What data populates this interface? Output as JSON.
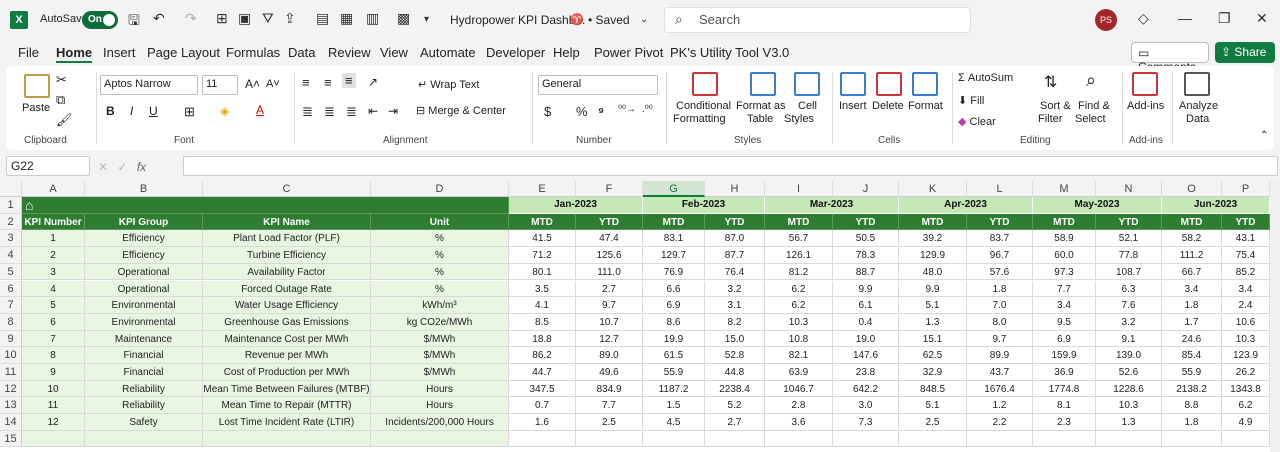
{
  "titlebar": {
    "app_icon": "X",
    "autosave_label": "AutoSave",
    "autosave_state": "On",
    "doc_title": "Hydropower KPI Dashb...",
    "saved_status": "• Saved",
    "search_placeholder": "Search",
    "avatar_initials": "PS"
  },
  "menu": [
    "File",
    "Home",
    "Insert",
    "Page Layout",
    "Formulas",
    "Data",
    "Review",
    "View",
    "Automate",
    "Developer",
    "Help",
    "Power Pivot",
    "PK's Utility Tool V3.0"
  ],
  "menu_active": "Home",
  "comments_label": "Comments",
  "share_label": "Share",
  "ribbon": {
    "paste": "Paste",
    "clipboard": "Clipboard",
    "font_name": "Aptos Narrow",
    "font_size": "11",
    "font_group": "Font",
    "wrap_text": "Wrap Text",
    "merge_center": "Merge & Center",
    "alignment_group": "Alignment",
    "number_format": "General",
    "number_group": "Number",
    "conditional_formatting_1": "Conditional",
    "conditional_formatting_2": "Formatting",
    "format_as_table_1": "Format as",
    "format_as_table_2": "Table",
    "cell_styles_1": "Cell",
    "cell_styles_2": "Styles",
    "styles_group": "Styles",
    "insert": "Insert",
    "delete": "Delete",
    "format": "Format",
    "cells_group": "Cells",
    "autosum": "AutoSum",
    "fill": "Fill",
    "clear": "Clear",
    "sort_filter_1": "Sort &",
    "sort_filter_2": "Filter",
    "find_select_1": "Find &",
    "find_select_2": "Select",
    "editing_group": "Editing",
    "addins": "Add-ins",
    "addins_group": "Add-ins",
    "analyze_data_1": "Analyze",
    "analyze_data_2": "Data"
  },
  "formula_bar": {
    "name_box": "G22",
    "fx": "fx"
  },
  "columns": [
    "A",
    "B",
    "C",
    "D",
    "E",
    "F",
    "G",
    "H",
    "I",
    "J",
    "K",
    "L",
    "M",
    "N",
    "O",
    "P"
  ],
  "selected_column": "G",
  "rows": [
    "1",
    "2",
    "3",
    "4",
    "5",
    "6",
    "7",
    "8",
    "9",
    "10",
    "11",
    "12",
    "13",
    "14",
    "15"
  ],
  "table": {
    "headers": [
      "KPI Number",
      "KPI Group",
      "KPI Name",
      "Unit"
    ],
    "months": [
      "Jan-2023",
      "Feb-2023",
      "Mar-2023",
      "Apr-2023",
      "May-2023",
      "Jun-2023"
    ],
    "mtd": "MTD",
    "ytd": "YTD",
    "kpis": [
      {
        "num": "1",
        "group": "Efficiency",
        "name": "Plant Load Factor (PLF)",
        "unit": "%",
        "vals": [
          "41.5",
          "47.4",
          "83.1",
          "87.0",
          "56.7",
          "50.5",
          "39.2",
          "83.7",
          "58.9",
          "52.1",
          "58.2",
          "43.1"
        ]
      },
      {
        "num": "2",
        "group": "Efficiency",
        "name": "Turbine Efficiency",
        "unit": "%",
        "vals": [
          "71.2",
          "125.6",
          "129.7",
          "87.7",
          "126.1",
          "78.3",
          "129.9",
          "96.7",
          "60.0",
          "77.8",
          "111.2",
          "75.4"
        ]
      },
      {
        "num": "3",
        "group": "Operational",
        "name": "Availability Factor",
        "unit": "%",
        "vals": [
          "80.1",
          "111.0",
          "76.9",
          "76.4",
          "81.2",
          "88.7",
          "48.0",
          "57.6",
          "97.3",
          "108.7",
          "66.7",
          "85.2"
        ]
      },
      {
        "num": "4",
        "group": "Operational",
        "name": "Forced Outage Rate",
        "unit": "%",
        "vals": [
          "3.5",
          "2.7",
          "6.6",
          "3.2",
          "6.2",
          "9.9",
          "9.9",
          "1.8",
          "7.7",
          "6.3",
          "3.4",
          "3.4"
        ]
      },
      {
        "num": "5",
        "group": "Environmental",
        "name": "Water Usage Efficiency",
        "unit": "kWh/m³",
        "vals": [
          "4.1",
          "9.7",
          "6.9",
          "3.1",
          "6.2",
          "6.1",
          "5.1",
          "7.0",
          "3.4",
          "7.6",
          "1.8",
          "2.4"
        ]
      },
      {
        "num": "6",
        "group": "Environmental",
        "name": "Greenhouse Gas Emissions",
        "unit": "kg CO2e/MWh",
        "vals": [
          "8.5",
          "10.7",
          "8.6",
          "8.2",
          "10.3",
          "0.4",
          "1.3",
          "8.0",
          "9.5",
          "3.2",
          "1.7",
          "10.6"
        ]
      },
      {
        "num": "7",
        "group": "Maintenance",
        "name": "Maintenance Cost per MWh",
        "unit": "$/MWh",
        "vals": [
          "18.8",
          "12.7",
          "19.9",
          "15.0",
          "10.8",
          "19.0",
          "15.1",
          "9.7",
          "6.9",
          "9.1",
          "24.6",
          "10.3"
        ]
      },
      {
        "num": "8",
        "group": "Financial",
        "name": "Revenue per MWh",
        "unit": "$/MWh",
        "vals": [
          "86.2",
          "89.0",
          "61.5",
          "52.8",
          "82.1",
          "147.6",
          "62.5",
          "89.9",
          "159.9",
          "139.0",
          "85.4",
          "123.9"
        ]
      },
      {
        "num": "9",
        "group": "Financial",
        "name": "Cost of Production per MWh",
        "unit": "$/MWh",
        "vals": [
          "44.7",
          "49.6",
          "55.9",
          "44.8",
          "63.9",
          "23.8",
          "32.9",
          "43.7",
          "36.9",
          "52.6",
          "55.9",
          "26.2"
        ]
      },
      {
        "num": "10",
        "group": "Reliability",
        "name": "Mean Time Between Failures (MTBF)",
        "unit": "Hours",
        "vals": [
          "347.5",
          "834.9",
          "1187.2",
          "2238.4",
          "1046.7",
          "642.2",
          "848.5",
          "1676.4",
          "1774.8",
          "1228.6",
          "2138.2",
          "1343.8"
        ]
      },
      {
        "num": "11",
        "group": "Reliability",
        "name": "Mean Time to Repair (MTTR)",
        "unit": "Hours",
        "vals": [
          "0.7",
          "7.7",
          "1.5",
          "5.2",
          "2.8",
          "3.0",
          "5.1",
          "1.2",
          "8.1",
          "10.3",
          "8.8",
          "6.2"
        ]
      },
      {
        "num": "12",
        "group": "Safety",
        "name": "Lost Time Incident Rate (LTIR)",
        "unit": "Incidents/200,000 Hours",
        "vals": [
          "1.6",
          "2.5",
          "4.5",
          "2.7",
          "3.6",
          "7.3",
          "2.5",
          "2.2",
          "2.3",
          "1.3",
          "1.8",
          "4.9"
        ]
      }
    ]
  },
  "colors": {
    "dark_green": "#2e7d32",
    "light_green": "#c5e8b7",
    "row_fill": "#e8f5e0",
    "excel_green": "#107c41"
  }
}
